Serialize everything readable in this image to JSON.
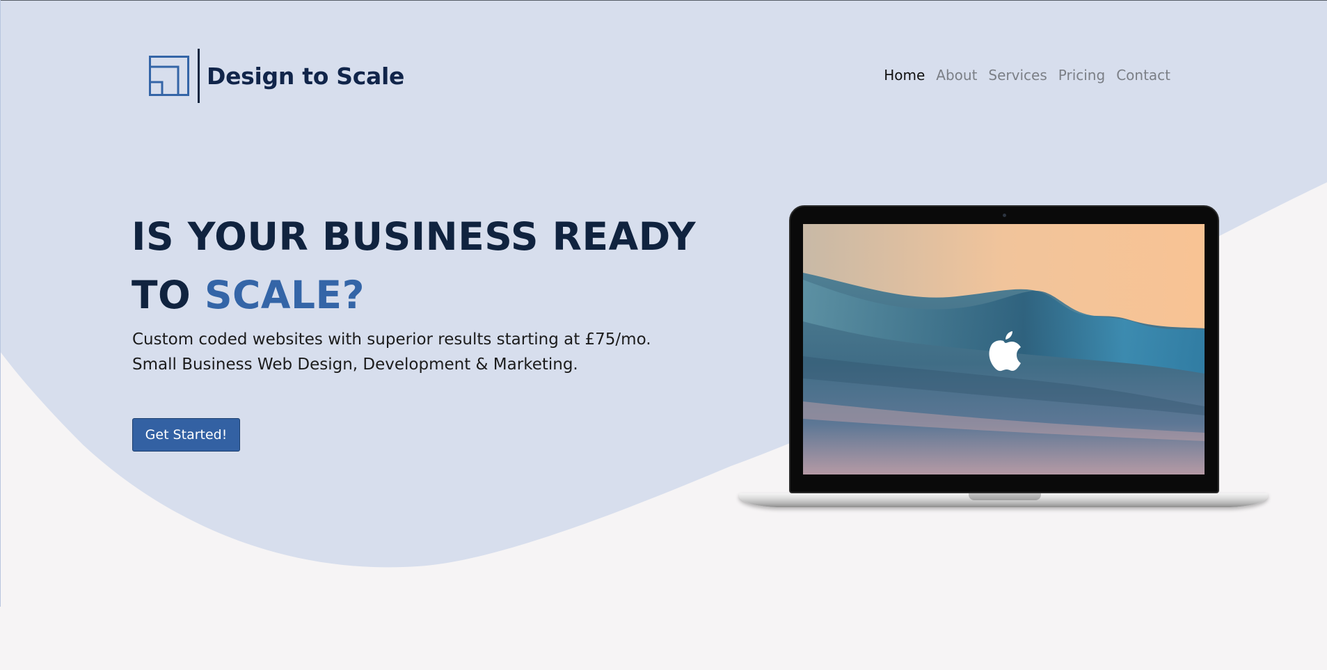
{
  "brand": {
    "name": "Design to Scale",
    "logo_icon": "nested-squares-icon",
    "logo_color": "#3465a7",
    "text_color": "#11254a"
  },
  "nav": {
    "active": "Home",
    "items": [
      {
        "label": "Home",
        "active": true
      },
      {
        "label": "About",
        "active": false
      },
      {
        "label": "Services",
        "active": false
      },
      {
        "label": "Pricing",
        "active": false
      },
      {
        "label": "Contact",
        "active": false
      }
    ]
  },
  "hero": {
    "headline_line1": "IS YOUR BUSINESS READY",
    "headline_line2_prefix": "TO",
    "headline_line2_accent": "SCALE?",
    "subtext_line1": "Custom coded websites with superior results starting at £75/mo.",
    "subtext_line2": "Small Business Web Design, Development & Marketing.",
    "cta_label": "Get Started!",
    "device_image": "laptop-wave-wallpaper",
    "device_logo_icon": "apple-logo-icon"
  },
  "colors": {
    "hero_background": "#d7deed",
    "page_background": "#f6f4f5",
    "heading": "#10233f",
    "accent": "#3465a7",
    "button": "#3361a3",
    "nav_active": "#111111",
    "nav_inactive": "#7b7f86"
  }
}
